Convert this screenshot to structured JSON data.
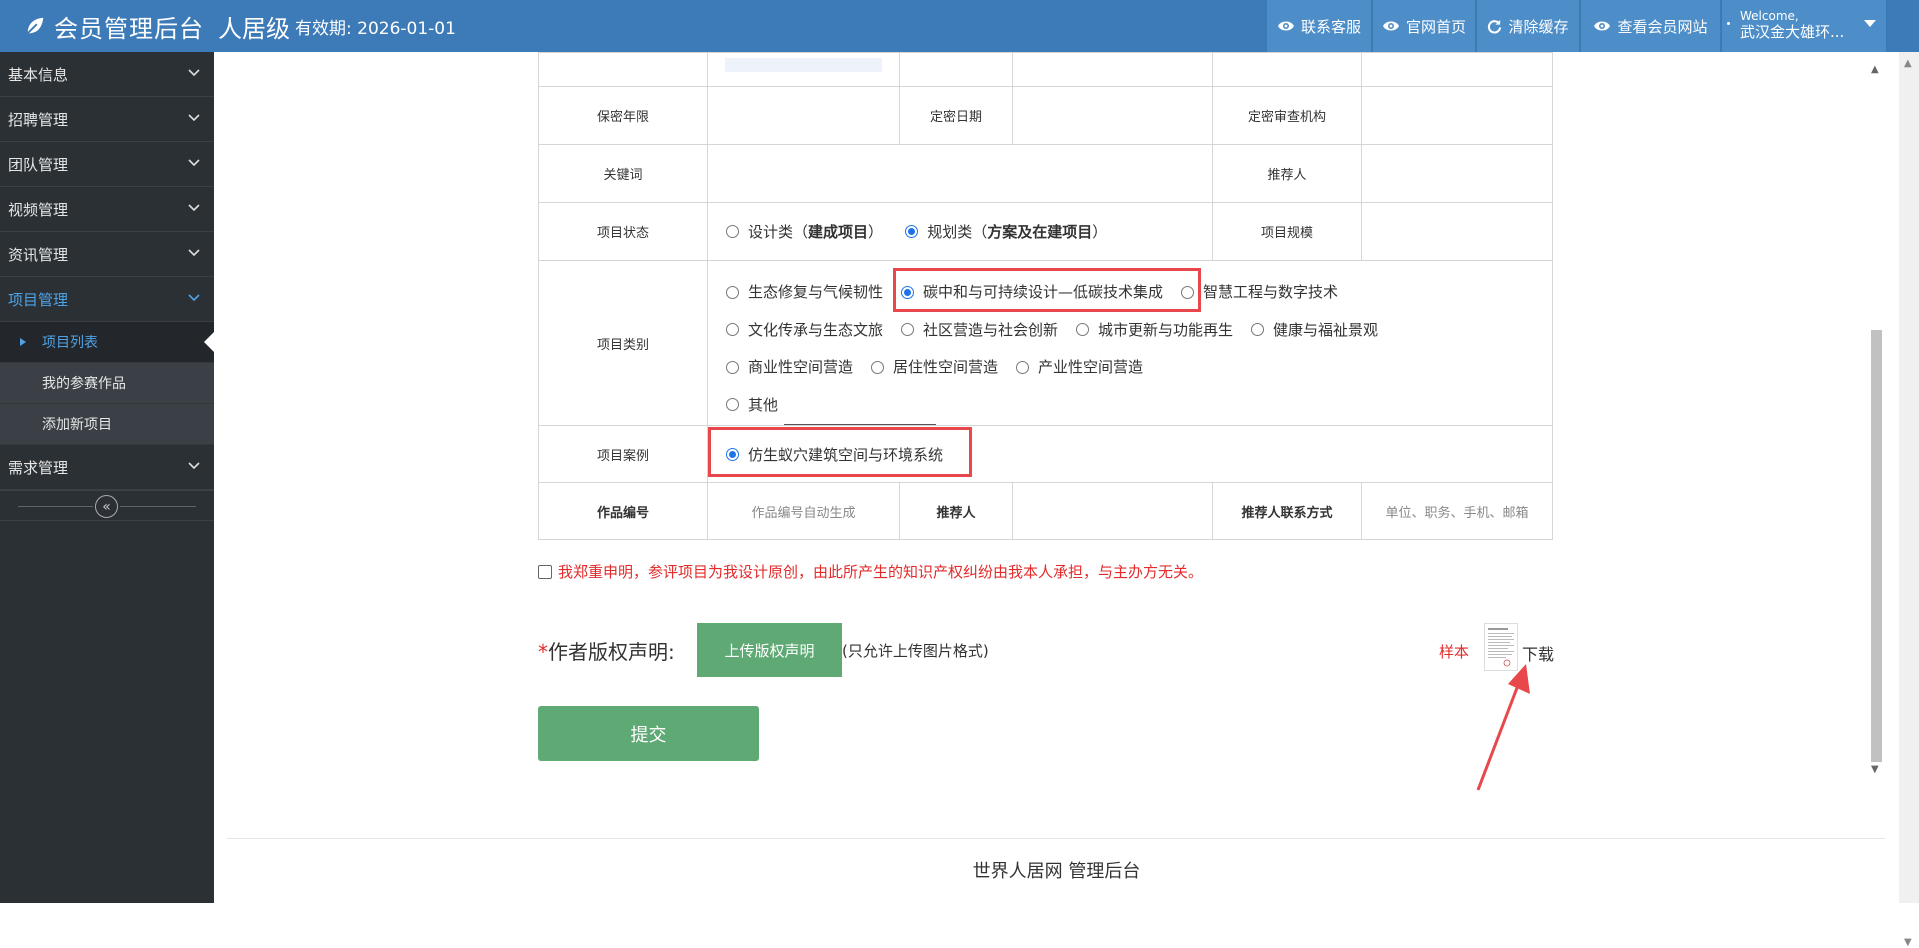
{
  "header": {
    "brand": "会员管理后台",
    "level": "人居级",
    "validity": "有效期: 2026-01-01",
    "buttons": [
      {
        "label": "联系客服",
        "icon": "eye-icon"
      },
      {
        "label": "官网首页",
        "icon": "eye-icon"
      },
      {
        "label": "清除缓存",
        "icon": "refresh-icon"
      },
      {
        "label": "查看会员网站",
        "icon": "eye-icon"
      }
    ],
    "user": {
      "welcome": "Welcome,",
      "name": "武汉金大雄环..."
    }
  },
  "sidebar": {
    "items": [
      {
        "label": "基本信息"
      },
      {
        "label": "招聘管理"
      },
      {
        "label": "团队管理"
      },
      {
        "label": "视频管理"
      },
      {
        "label": "资讯管理"
      },
      {
        "label": "项目管理"
      }
    ],
    "sub_items": [
      {
        "label": "项目列表"
      },
      {
        "label": "我的参赛作品"
      },
      {
        "label": "添加新项目"
      }
    ],
    "after": {
      "label": "需求管理"
    },
    "collapse_symbol": "«"
  },
  "form": {
    "secrecy_years": "保密年限",
    "classified_date": "定密日期",
    "review_org": "定密审查机构",
    "keywords": "关键词",
    "recommender": "推荐人",
    "status_label": "项目状态",
    "status_opt1_a": "设计类（",
    "status_opt1_b": "建成项目",
    "status_opt1_c": "）",
    "status_opt2_a": "规划类（",
    "status_opt2_b": "方案及在建项目",
    "status_opt2_c": "）",
    "scale_label": "项目规模",
    "category_label": "项目类别",
    "categories": [
      "生态修复与气候韧性",
      "碳中和与可持续设计—低碳技术集成",
      "智慧工程与数字技术",
      "文化传承与生态文旅",
      "社区营造与社会创新",
      "城市更新与功能再生",
      "健康与福祉景观",
      "商业性空间营造",
      "居住性空间营造",
      "产业性空间营造",
      "其他"
    ],
    "case_label": "项目案例",
    "case_option": "仿生蚁穴建筑空间与环境系统",
    "work_no_label": "作品编号",
    "work_no_placeholder": "作品编号自动生成",
    "recommender2": "推荐人",
    "contact_label": "推荐人联系方式",
    "contact_placeholder": "单位、职务、手机、邮箱"
  },
  "declaration": "我郑重申明，参评项目为我设计原创，由此所产生的知识产权纠纷由我本人承担，与主办方无关。",
  "copyright": {
    "star": "*",
    "label": "作者版权声明:",
    "upload": "上传版权声明",
    "note": "(只允许上传图片格式)",
    "sample": "样本",
    "download": "下载"
  },
  "submit": "提交",
  "footer": "世界人居网 管理后台",
  "colors": {
    "topbar": "#3c7ab8",
    "sidebar": "#2b3035",
    "green": "#5ea974",
    "highlight": "#e8474b"
  }
}
